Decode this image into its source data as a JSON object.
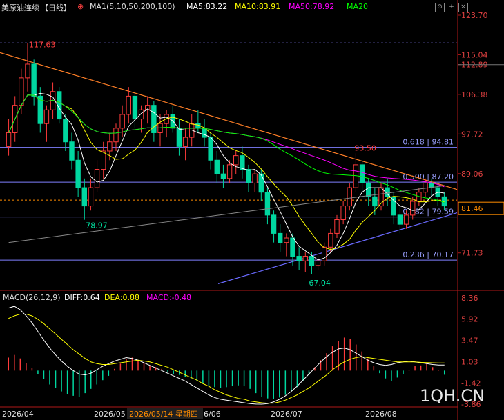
{
  "header": {
    "symbol": "美原油连续",
    "period": "【日线】",
    "ma_label": "MA1(5,10,50,200,100)",
    "ma5": "MA5:83.22",
    "ma10": "MA10:83.91",
    "ma50": "MA50:78.92",
    "ma20": "MA20",
    "colors": {
      "ma5": "#ffffff",
      "ma10": "#ffff00",
      "ma50": "#ff00ff",
      "ma20": "#00ff00"
    }
  },
  "watermark": "1QH.CN",
  "annotations": {
    "high": "117.63",
    "low_left": "78.97",
    "swing_high": "93.50",
    "swing_low": "67.04",
    "current_price_tag": "81.46",
    "date_tag": "2026/05/14 星期四"
  },
  "fib": [
    {
      "label": "0.618 | 94.81",
      "value": 94.81,
      "color": "#7f7fff"
    },
    {
      "label": "0.500 | 87.20",
      "value": 87.2,
      "color": "#7f7fff"
    },
    {
      "label": "0.382 | 79.59",
      "value": 79.59,
      "color": "#7f7fff"
    },
    {
      "label": "0.236 | 70.17",
      "value": 70.17,
      "color": "#7f7fff"
    }
  ],
  "macd": {
    "label": "MACD(26,12,9)",
    "diff": "DIFF:0.64",
    "dea": "DEA:0.88",
    "macd": "MACD:-0.48",
    "colors": {
      "diff": "#ffffff",
      "dea": "#ffff00",
      "macd": "#ff00ff"
    }
  },
  "chart_data": [
    {
      "type": "candlestick",
      "title": "美原油连续",
      "y_ticks": [
        "123.70",
        "115.04",
        "112.89",
        "106.38",
        "97.72",
        "89.06",
        "81.46",
        "71.73"
      ],
      "ylim": [
        64,
        124
      ],
      "x_ticks": [
        "2026/04",
        "2026/05",
        "2026/06",
        "2026/07",
        "2026/08"
      ],
      "candles": [
        [
          95,
          101,
          93,
          98
        ],
        [
          98,
          106,
          96,
          104
        ],
        [
          104,
          112,
          102,
          110
        ],
        [
          110,
          117.63,
          107,
          113
        ],
        [
          113,
          114,
          104,
          106
        ],
        [
          106,
          108,
          98,
          100
        ],
        [
          100,
          104,
          96,
          103
        ],
        [
          103,
          109,
          101,
          107
        ],
        [
          107,
          108,
          100,
          101
        ],
        [
          101,
          102,
          94,
          96
        ],
        [
          96,
          98,
          90,
          92
        ],
        [
          92,
          94,
          84,
          86
        ],
        [
          86,
          88,
          78.97,
          82
        ],
        [
          82,
          88,
          81,
          86
        ],
        [
          86,
          92,
          85,
          90
        ],
        [
          90,
          96,
          88,
          94
        ],
        [
          94,
          98,
          92,
          96
        ],
        [
          96,
          100,
          94,
          99
        ],
        [
          99,
          104,
          97,
          102
        ],
        [
          102,
          108,
          100,
          106
        ],
        [
          106,
          107,
          99,
          101
        ],
        [
          101,
          104,
          98,
          103
        ],
        [
          103,
          106,
          100,
          104
        ],
        [
          104,
          105,
          96,
          98
        ],
        [
          98,
          102,
          95,
          100
        ],
        [
          100,
          103,
          97,
          102
        ],
        [
          102,
          104,
          98,
          99
        ],
        [
          99,
          101,
          93,
          95
        ],
        [
          95,
          99,
          92,
          97
        ],
        [
          97,
          102,
          95,
          100
        ],
        [
          100,
          103,
          98,
          99
        ],
        [
          99,
          101,
          95,
          97
        ],
        [
          97,
          98,
          90,
          92
        ],
        [
          92,
          94,
          87,
          89
        ],
        [
          89,
          91,
          86,
          88
        ],
        [
          88,
          92,
          87,
          91
        ],
        [
          91,
          94,
          89,
          93
        ],
        [
          93,
          95,
          88,
          90
        ],
        [
          90,
          91,
          85,
          87
        ],
        [
          87,
          90,
          85,
          89
        ],
        [
          89,
          90,
          83,
          85
        ],
        [
          85,
          86,
          78,
          80
        ],
        [
          80,
          81,
          74,
          76
        ],
        [
          76,
          78,
          72,
          74
        ],
        [
          74,
          76,
          71,
          75
        ],
        [
          75,
          76,
          69,
          71
        ],
        [
          71,
          73,
          68,
          70
        ],
        [
          70,
          72,
          67.5,
          71
        ],
        [
          71,
          72,
          67.04,
          69
        ],
        [
          69,
          71,
          68,
          70
        ],
        [
          70,
          74,
          69,
          73
        ],
        [
          73,
          77,
          72,
          76
        ],
        [
          76,
          80,
          75,
          79
        ],
        [
          79,
          83,
          78,
          82
        ],
        [
          82,
          87,
          81,
          86
        ],
        [
          86,
          93.5,
          85,
          91
        ],
        [
          91,
          92,
          85,
          87
        ],
        [
          87,
          88,
          82,
          84
        ],
        [
          84,
          86,
          80,
          82
        ],
        [
          82,
          87,
          81,
          86
        ],
        [
          86,
          88,
          82,
          84
        ],
        [
          84,
          85,
          78,
          80
        ],
        [
          80,
          82,
          76,
          78
        ],
        [
          78,
          81,
          77,
          80
        ],
        [
          80,
          84,
          79,
          83
        ],
        [
          83,
          86,
          82,
          85
        ],
        [
          85,
          88,
          84,
          87
        ],
        [
          87,
          88,
          84,
          86
        ],
        [
          86,
          87,
          82,
          84
        ],
        [
          84,
          85,
          81,
          82
        ]
      ],
      "series": [
        {
          "name": "MA5",
          "color": "#ffffff"
        },
        {
          "name": "MA10",
          "color": "#ffff00"
        },
        {
          "name": "MA50",
          "color": "#ff00ff"
        },
        {
          "name": "MA20",
          "color": "#00ff00"
        }
      ],
      "current_price": 81.46
    },
    {
      "type": "bar",
      "title": "MACD(26,12,9)",
      "y_ticks": [
        "8.36",
        "5.92",
        "3.47",
        "1.03",
        "-1.42",
        "-3.86"
      ],
      "ylim": [
        -3.86,
        8.36
      ],
      "histogram": [
        1.5,
        1.8,
        1.4,
        0.9,
        0.3,
        -0.4,
        -1.0,
        -1.6,
        -2.0,
        -2.4,
        -2.7,
        -2.9,
        -3.0,
        -2.6,
        -2.1,
        -1.6,
        -1.1,
        -0.6,
        0.2,
        0.8,
        1.3,
        1.5,
        1.2,
        0.9,
        0.6,
        0.4,
        0.2,
        -0.1,
        -0.4,
        -0.5,
        -0.7,
        -0.9,
        -1.2,
        -1.5,
        -1.7,
        -1.9,
        -2.0,
        -1.9,
        -1.8,
        -1.7,
        -1.8,
        -2.1,
        -2.6,
        -3.0,
        -3.2,
        -3.3,
        -3.1,
        -2.8,
        -2.4,
        -1.9,
        -1.2,
        -0.5,
        0.4,
        1.2,
        2.0,
        2.8,
        3.4,
        3.8,
        3.6,
        3.0,
        2.2,
        1.4,
        0.5,
        -0.3,
        -0.9,
        -1.2,
        -0.8,
        -0.4,
        0.1,
        0.5,
        0.6,
        0.8,
        0.4,
        0.1,
        -0.48
      ],
      "diff": [
        7.2,
        7.4,
        7.0,
        6.3,
        5.5,
        4.5,
        3.5,
        2.6,
        1.8,
        1.1,
        0.5,
        0.0,
        -0.4,
        -0.5,
        -0.3,
        0.1,
        0.5,
        0.8,
        1.1,
        1.3,
        1.5,
        1.4,
        1.2,
        0.9,
        0.6,
        0.3,
        0.0,
        -0.3,
        -0.6,
        -0.9,
        -1.2,
        -1.6,
        -2.0,
        -2.4,
        -2.8,
        -3.1,
        -3.3,
        -3.4,
        -3.5,
        -3.6,
        -3.7,
        -3.8,
        -3.85,
        -3.86,
        -3.8,
        -3.6,
        -3.3,
        -2.9,
        -2.4,
        -1.8,
        -1.1,
        -0.4,
        0.3,
        1.0,
        1.6,
        2.1,
        2.5,
        2.6,
        2.4,
        2.0,
        1.6,
        1.2,
        0.9,
        0.7,
        0.6,
        0.7,
        0.9,
        1.0,
        1.1,
        1.0,
        0.9,
        0.8,
        0.7,
        0.64,
        0.64
      ],
      "dea": [
        6.0,
        6.3,
        6.5,
        6.5,
        6.3,
        5.9,
        5.4,
        4.8,
        4.2,
        3.6,
        3.0,
        2.4,
        1.9,
        1.4,
        1.0,
        0.8,
        0.7,
        0.7,
        0.8,
        0.9,
        1.0,
        1.1,
        1.2,
        1.1,
        1.0,
        0.8,
        0.6,
        0.4,
        0.1,
        -0.2,
        -0.5,
        -0.8,
        -1.1,
        -1.5,
        -1.8,
        -2.2,
        -2.5,
        -2.8,
        -3.0,
        -3.2,
        -3.3,
        -3.5,
        -3.6,
        -3.7,
        -3.75,
        -3.75,
        -3.6,
        -3.4,
        -3.1,
        -2.8,
        -2.4,
        -2.0,
        -1.5,
        -1.0,
        -0.5,
        0.1,
        0.6,
        1.0,
        1.3,
        1.5,
        1.6,
        1.5,
        1.4,
        1.3,
        1.2,
        1.1,
        1.0,
        1.0,
        1.0,
        1.0,
        0.95,
        0.92,
        0.9,
        0.88,
        0.88
      ]
    }
  ]
}
